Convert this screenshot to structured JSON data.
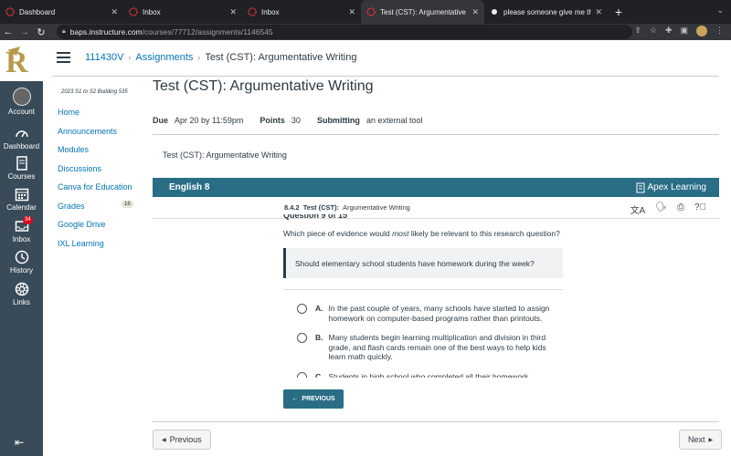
{
  "browser": {
    "tabs": [
      {
        "title": "Dashboard",
        "active": false
      },
      {
        "title": "Inbox",
        "active": false
      },
      {
        "title": "Inbox",
        "active": false
      },
      {
        "title": "Test (CST): Argumentative Writ",
        "active": true
      },
      {
        "title": "please someone give me the a",
        "active": false
      }
    ],
    "new_tab": "+",
    "url_host": "baps.instructure.com",
    "url_path": "/courses/77712/assignments/1146545"
  },
  "global_nav": {
    "account": "Account",
    "dashboard": "Dashboard",
    "courses": "Courses",
    "calendar": "Calendar",
    "inbox": "Inbox",
    "inbox_badge": "34",
    "history": "History",
    "links": "Links"
  },
  "breadcrumb": {
    "course": "111430V",
    "section": "Assignments",
    "current": "Test (CST): Argumentative Writing"
  },
  "course_nav": {
    "term": "2023 S1 to S2 Building 535",
    "items": [
      "Home",
      "Announcements",
      "Modules",
      "Discussions",
      "Canva for Education",
      "Grades",
      "Google Drive",
      "IXL Learning"
    ],
    "grades_count": "16"
  },
  "assignment": {
    "title": "Test (CST): Argumentative Writing",
    "due_label": "Due",
    "due_value": "Apr 20 by 11:59pm",
    "points_label": "Points",
    "points_value": "30",
    "submitting_label": "Submitting",
    "submitting_value": "an external tool",
    "tool_title": "Test (CST): Argumentative Writing"
  },
  "apex": {
    "course": "English 8",
    "brand": "Apex Learning",
    "lesson_num": "8.4.2",
    "lesson_type": "Test (CST):",
    "lesson_name": "Argumentative Writing",
    "question_header": "Question 9 of 15",
    "question": "Which piece of evidence would most likely be relevant to this research question?",
    "research_question": "Should elementary school students have homework during the week?",
    "options": [
      {
        "letter": "A.",
        "text": "In the past couple of years, many schools have started to assign homework on computer-based programs rather than printouts."
      },
      {
        "letter": "B.",
        "text": "Many students begin learning multiplication and division in third grade, and flash cards remain one of the best ways to help kids learn math quickly."
      },
      {
        "letter": "C.",
        "text": "Students in high school who completed all their homework"
      }
    ],
    "previous_label": "PREVIOUS"
  },
  "pager": {
    "previous": "Previous",
    "next": "Next"
  },
  "colors": {
    "canvas_nav": "#394b58",
    "apex_teal": "#2a6e86",
    "link": "#0374b5"
  }
}
